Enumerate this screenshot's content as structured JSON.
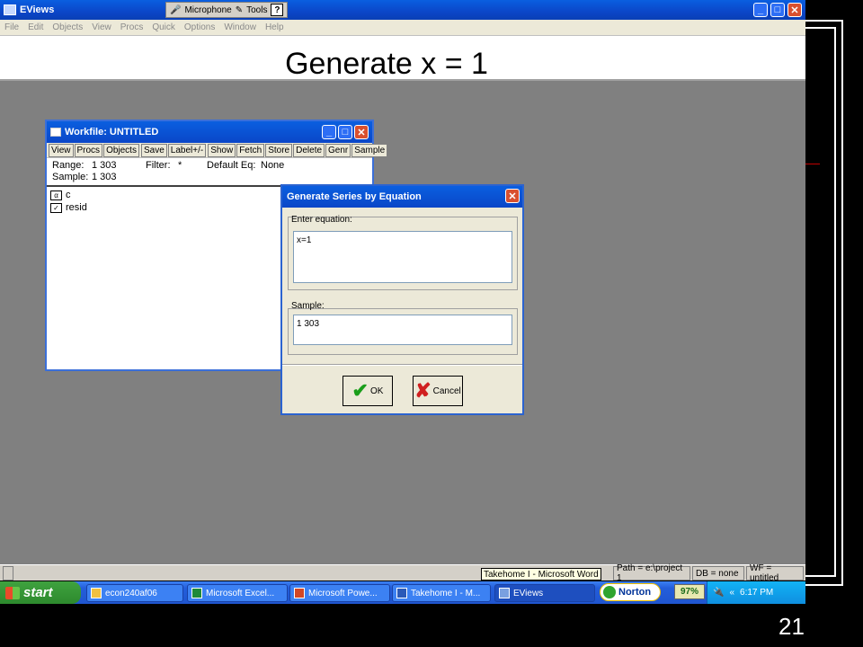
{
  "app": {
    "title": "EViews",
    "lang_bar": {
      "microphone": "Microphone",
      "tools": "Tools",
      "help": "?"
    },
    "menu": [
      "File",
      "Edit",
      "Objects",
      "View",
      "Procs",
      "Quick",
      "Options",
      "Window",
      "Help"
    ]
  },
  "slide": {
    "title": "Generate x = 1",
    "number": "21"
  },
  "workfile": {
    "title": "Workfile: UNTITLED",
    "toolbar": [
      "View",
      "Procs",
      "Objects",
      "Save",
      "Label+/-",
      "Show",
      "Fetch",
      "Store",
      "Delete",
      "Genr",
      "Sample"
    ],
    "range_label": "Range:",
    "range_value": "1 303",
    "filter_label": "Filter:",
    "filter_value": "*",
    "default_eq_label": "Default Eq:",
    "default_eq_value": "None",
    "sample_label": "Sample:",
    "sample_value": "1 303",
    "objects": [
      {
        "icon": "coefficient-icon",
        "glyph": "α",
        "name": "c"
      },
      {
        "icon": "series-icon",
        "glyph": "✓",
        "name": "resid"
      }
    ]
  },
  "dialog": {
    "title": "Generate Series by Equation",
    "equation_label": "Enter equation:",
    "equation_value": "x=1",
    "sample_label": "Sample:",
    "sample_value": "1 303",
    "ok_label": "OK",
    "cancel_label": "Cancel"
  },
  "status": {
    "path": "Path = e:\\project 1",
    "db": "DB = none",
    "wf": "WF = untitled",
    "tooltip": "Takehome I - Microsoft Word"
  },
  "taskbar": {
    "start": "start",
    "tasks": [
      "econ240af06",
      "Microsoft Excel...",
      "Microsoft Powe...",
      "Takehome I - M...",
      "EViews"
    ],
    "norton": "Norton",
    "battery": "97%",
    "clock": "6:17 PM"
  },
  "colors": {
    "titlebar": "#0a46c8",
    "workspace": "#808080",
    "taskbar": "#245edb",
    "start": "#2d8a2d"
  }
}
